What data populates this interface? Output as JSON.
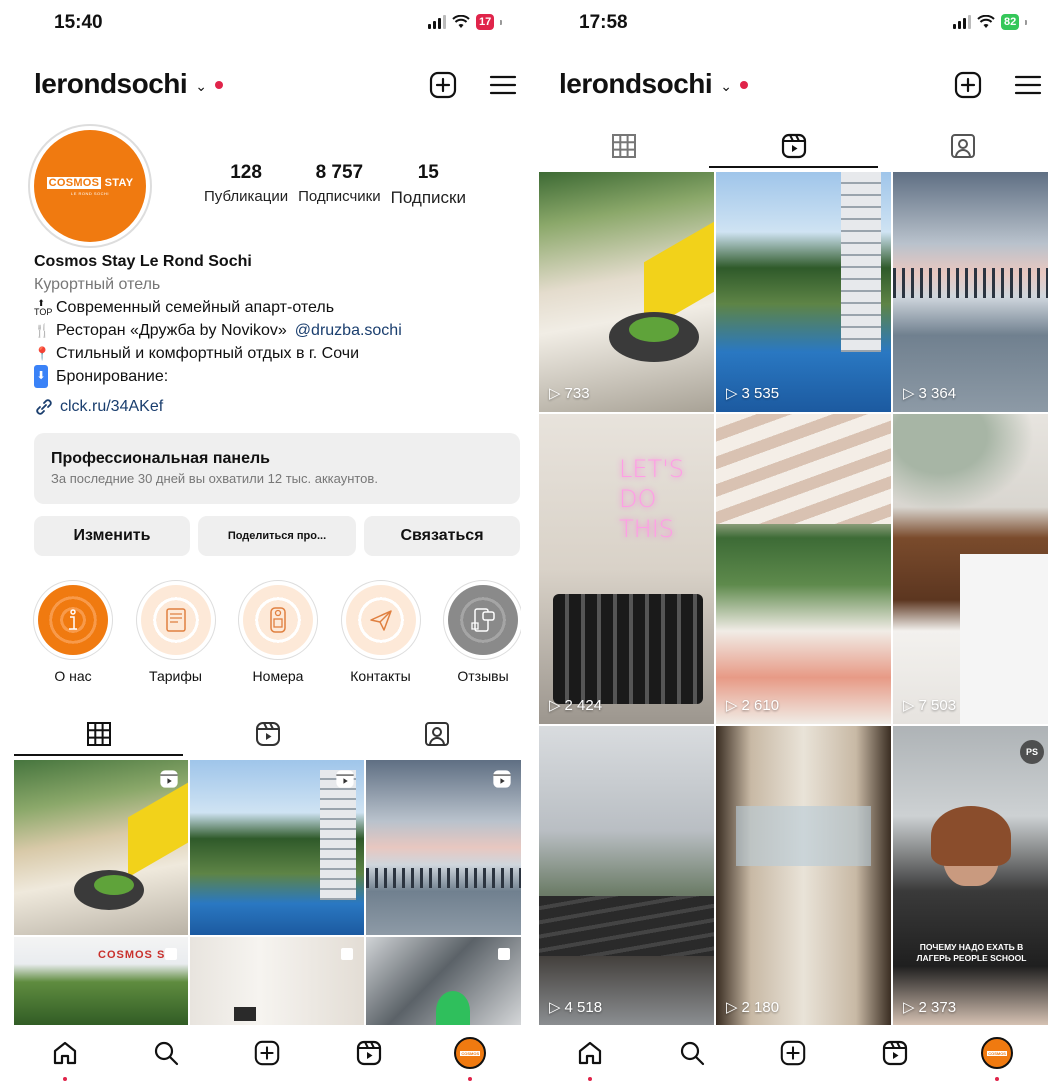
{
  "left": {
    "status": {
      "time": "15:40",
      "battery": "17",
      "battery_color": "#e0244a"
    },
    "header": {
      "username": "lerondsochi"
    },
    "profile": {
      "logo_word1": "COSMOS",
      "logo_word2": "STAY",
      "logo_sub": "LE ROND SOCHI",
      "stats": [
        {
          "num": "128",
          "label": "Публикации"
        },
        {
          "num": "8 757",
          "label": "Подписчики"
        },
        {
          "num": "15",
          "label": "Подписки"
        }
      ]
    },
    "bio": {
      "name": "Cosmos Stay Le Rond Sochi",
      "category": "Курортный отель",
      "lines": [
        {
          "icon": "top-arrow-icon",
          "text": "Современный семейный апарт-отель"
        },
        {
          "icon": "fork-knife-icon",
          "text": "Ресторан «Дружба by Novikov»",
          "mention": "@druzba.sochi"
        },
        {
          "icon": "pin-icon",
          "text": "Стильный и комфортный отдых в г. Сочи"
        },
        {
          "icon": "down-arrow-icon",
          "text": "Бронирование:"
        }
      ],
      "link": "clck.ru/34AKef"
    },
    "pro_panel": {
      "title": "Профессиональная панель",
      "subtitle": "За последние 30 дней вы охватили 12 тыс. аккаунтов."
    },
    "buttons": {
      "edit": "Изменить",
      "share": "Поделиться про...",
      "contact": "Связаться"
    },
    "highlights": [
      {
        "label": "О нас",
        "icon": "info-icon"
      },
      {
        "label": "Тарифы",
        "icon": "price-list-icon"
      },
      {
        "label": "Номера",
        "icon": "door-hanger-icon"
      },
      {
        "label": "Контакты",
        "icon": "paper-plane-icon"
      },
      {
        "label": "Отзывы",
        "icon": "review-icon"
      }
    ]
  },
  "right": {
    "status": {
      "time": "17:58",
      "battery": "82",
      "battery_color": "#34c759"
    },
    "header": {
      "username": "lerondsochi"
    },
    "reels": [
      {
        "views": "733"
      },
      {
        "views": "3 535"
      },
      {
        "views": "3 364"
      },
      {
        "views": "2 424"
      },
      {
        "views": "2 610"
      },
      {
        "views": "7 503"
      },
      {
        "views": "4 518"
      },
      {
        "views": "2 180"
      },
      {
        "views": "2 373"
      }
    ],
    "neon_lines": [
      "LET'S",
      "DO",
      "THIS"
    ],
    "ps_badge": "PS",
    "overlay_text": [
      "ПОЧЕМУ НАДО ЕХАТЬ В",
      "ЛАГЕРЬ PEOPLE SCHOOL"
    ]
  },
  "left_grid": {
    "building_text": "COSMOS ST"
  },
  "colors": {
    "accent": "#f07a10",
    "link": "#1a3e6e",
    "notify": "#e0244a"
  }
}
